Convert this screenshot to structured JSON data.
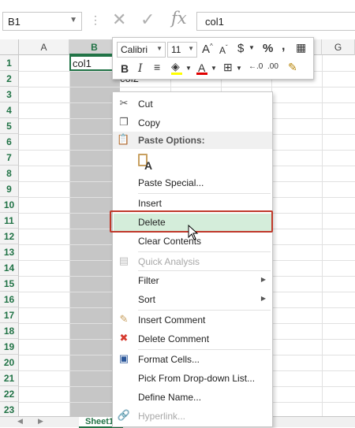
{
  "formula_bar": {
    "name_box": "B1",
    "cancel_icon": "cancel-icon",
    "enter_icon": "enter-icon",
    "fx_label": "fx",
    "formula_value": "col1"
  },
  "grid": {
    "columns": [
      "A",
      "B",
      "C",
      "D",
      "E",
      "F",
      "G"
    ],
    "rows": [
      "1",
      "2",
      "3",
      "4",
      "5",
      "6",
      "7",
      "8",
      "9",
      "10",
      "11",
      "12",
      "13",
      "14",
      "15",
      "16",
      "17",
      "18",
      "19",
      "20",
      "21",
      "22",
      "23"
    ],
    "cell_b1": "col1",
    "cell_c2": "col2",
    "selected_column": "B",
    "accent": "#217346"
  },
  "mini_toolbar": {
    "font_name": "Calibri",
    "font_size": "11",
    "grow_font": "A",
    "shrink_font": "A",
    "currency": "$",
    "percent": "%",
    "comma": ",",
    "bold": "B",
    "italic": "I",
    "font_color": "A"
  },
  "context_menu": {
    "cut": "Cut",
    "copy": "Copy",
    "paste_options": "Paste Options:",
    "paste_special": "Paste Special...",
    "insert": "Insert",
    "delete": "Delete",
    "clear_contents": "Clear Contents",
    "quick_analysis": "Quick Analysis",
    "filter": "Filter",
    "sort": "Sort",
    "insert_comment": "Insert Comment",
    "delete_comment": "Delete Comment",
    "format_cells": "Format Cells...",
    "pick_from_list": "Pick From Drop-down List...",
    "define_name": "Define Name...",
    "hyperlink": "Hyperlink..."
  },
  "sheet_tab": "Sheet1",
  "colors": {
    "highlight_border": "#c0392b",
    "highlight_fill": "#d4edda",
    "selection_gray": "#c6c6c6"
  }
}
